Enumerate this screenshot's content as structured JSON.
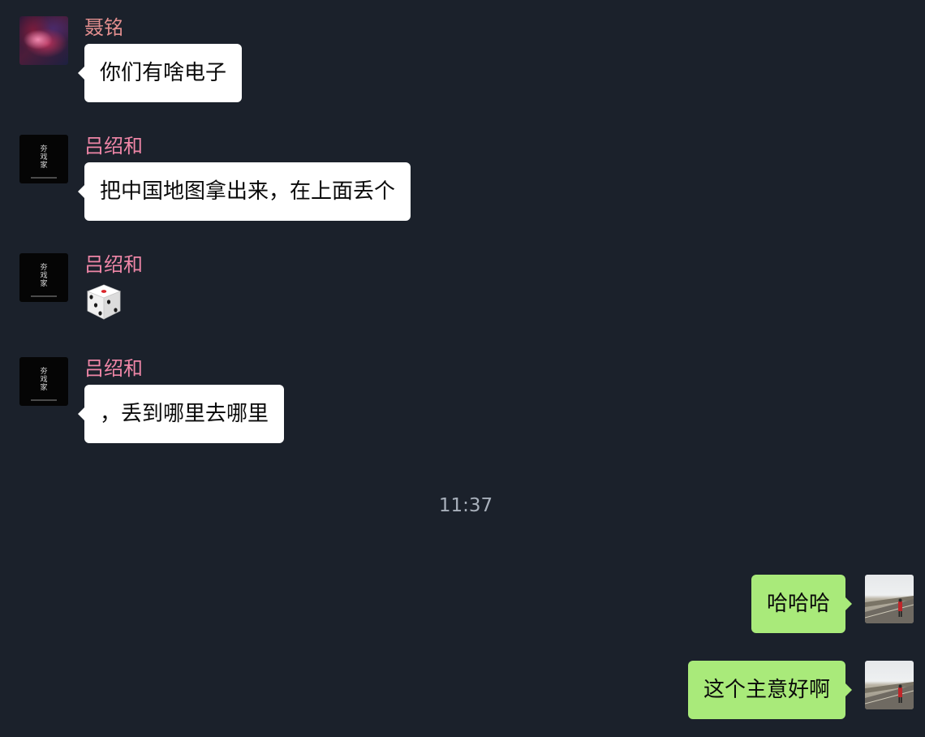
{
  "messages": [
    {
      "sender": "聂铭",
      "text": "你们有啥电子"
    },
    {
      "sender": "吕绍和",
      "text": "把中国地图拿出来，在上面丢个"
    },
    {
      "sender": "吕绍和",
      "sticker": "dice-icon",
      "dice_face": 3
    },
    {
      "sender": "吕绍和",
      "text": "，丢到哪里去哪里"
    },
    {
      "text": "哈哈哈"
    },
    {
      "text": "这个主意好啊"
    }
  ],
  "timestamp": "11:37",
  "colors": {
    "background": "#1b212b",
    "incoming_bubble": "#ffffff",
    "outgoing_bubble": "#a9ea7a",
    "sender_nie": "#e38f8f",
    "sender_lv": "#ef86a7",
    "timestamp": "#a8b0bb"
  }
}
